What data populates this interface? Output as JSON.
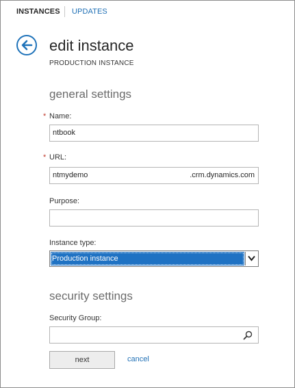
{
  "nav": {
    "tabs": [
      {
        "label": "INSTANCES"
      },
      {
        "label": "UPDATES"
      }
    ]
  },
  "header": {
    "title": "edit instance",
    "subtitle": "PRODUCTION INSTANCE"
  },
  "general": {
    "heading": "general settings",
    "name": {
      "label": "Name:",
      "required_mark": "*",
      "value": "ntbook"
    },
    "url": {
      "label": "URL:",
      "required_mark": "*",
      "value": "ntmydemo",
      "suffix": ".crm.dynamics.com"
    },
    "purpose": {
      "label": "Purpose:",
      "value": ""
    },
    "instance_type": {
      "label": "Instance type:",
      "selected": "Production instance"
    }
  },
  "security": {
    "heading": "security settings",
    "group": {
      "label": "Security Group:",
      "value": ""
    }
  },
  "actions": {
    "next": "next",
    "cancel": "cancel"
  },
  "colors": {
    "accent": "#1e72b9",
    "selection": "#1f72c3",
    "required": "#c0392b"
  },
  "icons": {
    "back": "back-arrow-icon",
    "dropdown": "chevron-down-icon",
    "search": "search-icon"
  }
}
